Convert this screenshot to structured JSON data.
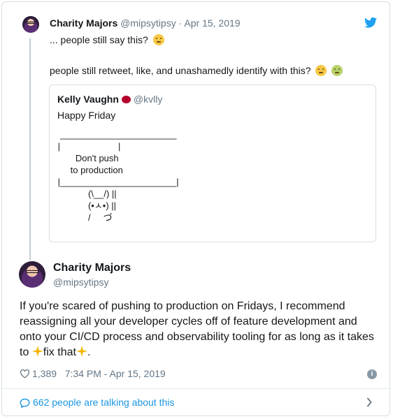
{
  "colors": {
    "brand": "#1da1f2",
    "link": "#1b95e0",
    "muted": "#657786",
    "text": "#14171a"
  },
  "icons": {
    "brand": "twitter-bird-icon",
    "like": "heart-icon",
    "info": "info-icon",
    "talk": "speech-bubble-icon",
    "more": "chevron-right-icon"
  },
  "reply": {
    "name": "Charity Majors",
    "handle": "@mipsytipsy",
    "sep": "·",
    "date": "Apr 15, 2019",
    "line1": "... people still say this?",
    "line2": "people still retweet, like, and unashamedly identify with this?"
  },
  "quote": {
    "name": "Kelly Vaughn",
    "handle": "@kvlly",
    "text": "Happy Friday",
    "ascii": "  _______________________\n |                       |\n        Don't push\n      to production\n |_______________________|\n             (\\__/) ||\n             (•ㅅ•) ||\n             /     づ"
  },
  "main": {
    "name": "Charity Majors",
    "handle": "@mipsytipsy",
    "text_before": "If you're scared of pushing to production on Fridays, I recommend reassigning all your developer cycles off of feature development and onto your CI/CD process and observability tooling for as long as it takes to ",
    "text_mid": "fix that",
    "text_after": ".",
    "likes": "1,389",
    "timestamp": "7:34 PM - Apr 15, 2019",
    "talking": "662 people are talking about this"
  }
}
